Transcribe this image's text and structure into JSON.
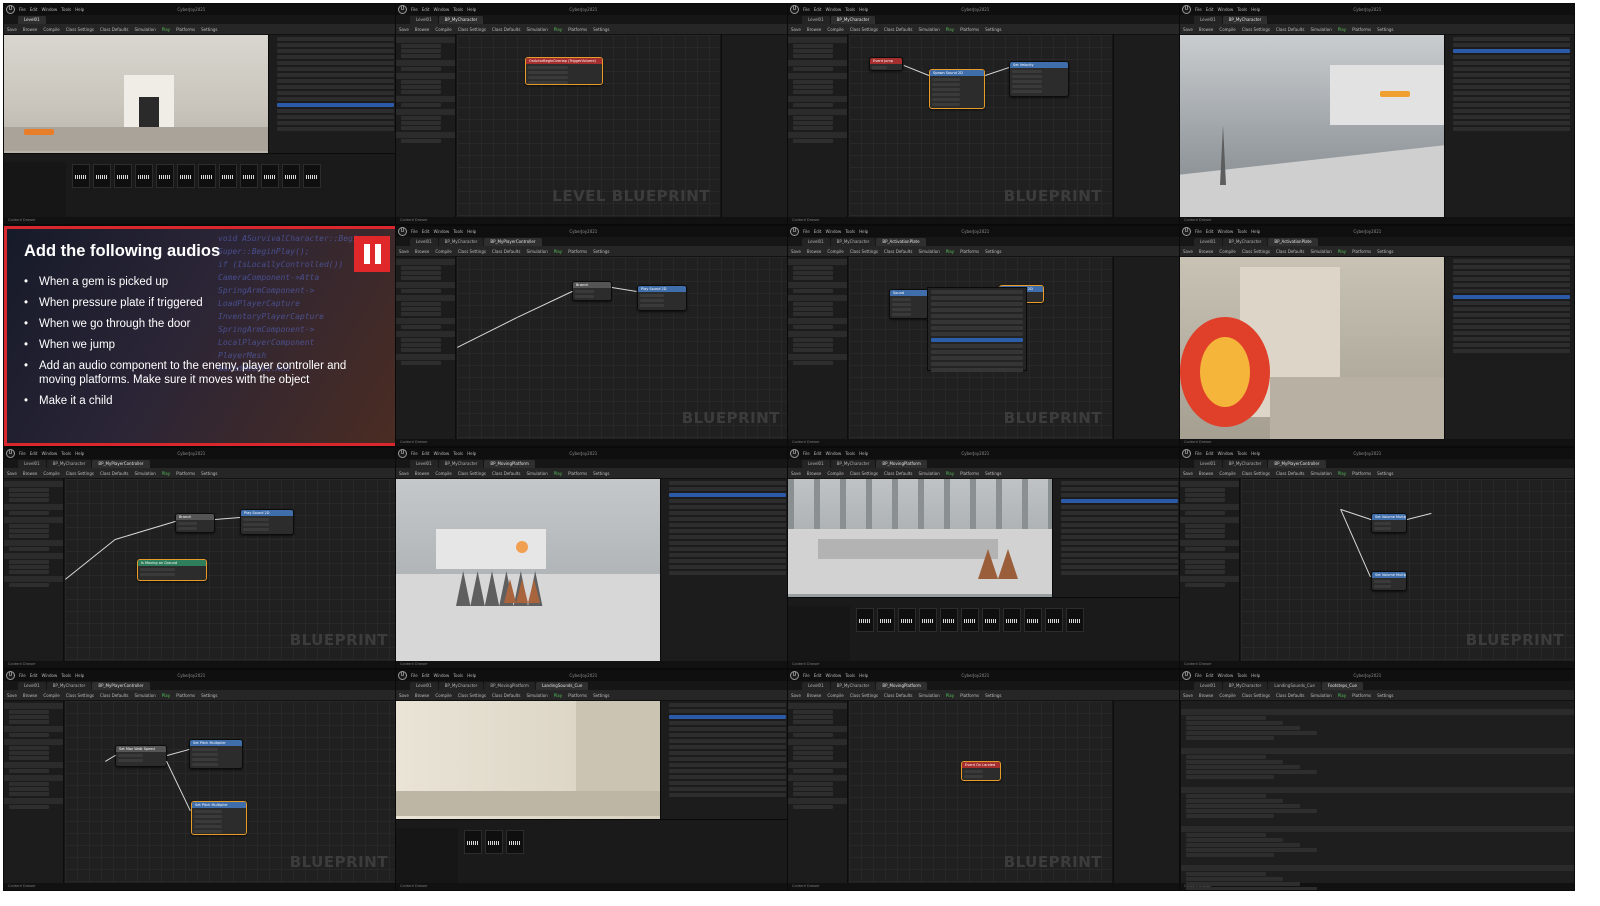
{
  "editor": {
    "project_name": "CyberJoy2021",
    "menu_items": [
      "File",
      "Edit",
      "Window",
      "Tools",
      "Help"
    ],
    "toolbar": [
      "Save",
      "Browse",
      "Compile",
      "Class Settings",
      "Class Defaults",
      "Simulation",
      "Play",
      "Platforms",
      "Settings"
    ],
    "status_text": "Content Drawer"
  },
  "tiles": [
    {
      "id": "t1",
      "kind": "level",
      "tabs": [
        "Level01"
      ]
    },
    {
      "id": "t2",
      "kind": "blueprint",
      "tabs": [
        "Level01",
        "BP_MyCharacter"
      ],
      "watermark": "LEVEL BLUEPRINT",
      "nodes": [
        {
          "title": "OnActorBeginOverlap (TriggerVolume)",
          "color": "#a52e2e"
        }
      ]
    },
    {
      "id": "t3",
      "kind": "blueprint",
      "tabs": [
        "Level01",
        "BP_MyCharacter"
      ],
      "watermark": "BLUEPRINT",
      "nodes": [
        {
          "title": "Event Jump",
          "color": "#a52e2e"
        },
        {
          "title": "Spawn Sound 2D",
          "color": "#3f6eaa"
        },
        {
          "title": "Set Velocity",
          "color": "#3f6eaa"
        }
      ]
    },
    {
      "id": "t4",
      "kind": "viewport-outliner",
      "tabs": [
        "Level01",
        "BP_MyCharacter"
      ]
    },
    {
      "id": "t5",
      "kind": "slide"
    },
    {
      "id": "t6",
      "kind": "blueprint",
      "tabs": [
        "Level01",
        "BP_MyCharacter",
        "BP_MyPlayerController"
      ],
      "watermark": "BLUEPRINT",
      "nodes": [
        {
          "title": "Branch",
          "color": "#555555"
        },
        {
          "title": "Play Sound 2D",
          "color": "#3f6eaa"
        }
      ]
    },
    {
      "id": "t7",
      "kind": "blueprint-menu",
      "tabs": [
        "Level01",
        "BP_MyCharacter",
        "BP_ActivationPlate"
      ],
      "watermark": "BLUEPRINT",
      "nodes": [
        {
          "title": "Sound",
          "color": "#3f6eaa"
        },
        {
          "title": "Spawn Sound 2D",
          "color": "#3f6eaa"
        }
      ]
    },
    {
      "id": "t8",
      "kind": "viewport-menu",
      "tabs": [
        "Level01",
        "BP_MyCharacter",
        "BP_ActivationPlate"
      ]
    },
    {
      "id": "t9",
      "kind": "blueprint",
      "tabs": [
        "Level01",
        "BP_MyCharacter",
        "BP_MyPlayerController"
      ],
      "watermark": "BLUEPRINT",
      "nodes": [
        {
          "title": "Branch",
          "color": "#555555"
        },
        {
          "title": "Play Sound 2D",
          "color": "#3f6eaa"
        },
        {
          "title": "Is Moving on Ground",
          "color": "#2e7d5b"
        }
      ]
    },
    {
      "id": "t10",
      "kind": "viewport-outliner",
      "tabs": [
        "Level01",
        "BP_MyCharacter",
        "BP_MovingPlatform"
      ]
    },
    {
      "id": "t11",
      "kind": "viewport-browser",
      "tabs": [
        "Level01",
        "BP_MyCharacter",
        "BP_MovingPlatform"
      ]
    },
    {
      "id": "t12",
      "kind": "blueprint",
      "tabs": [
        "Level01",
        "BP_MyCharacter",
        "BP_MyPlayerController"
      ],
      "watermark": "BLUEPRINT",
      "nodes": [
        {
          "title": "Set Volume Multiplier",
          "color": "#3f6eaa"
        },
        {
          "title": "Set Volume Multiplier",
          "color": "#3f6eaa"
        }
      ]
    },
    {
      "id": "t13",
      "kind": "blueprint",
      "tabs": [
        "Level01",
        "BP_MyCharacter",
        "BP_MyPlayerController"
      ],
      "watermark": "BLUEPRINT",
      "nodes": [
        {
          "title": "Set Max Walk Speed",
          "color": "#555555"
        },
        {
          "title": "Set Pitch Multiplier",
          "color": "#3f6eaa"
        },
        {
          "title": "Set Pitch Multiplier",
          "color": "#3f6eaa"
        }
      ]
    },
    {
      "id": "t14",
      "kind": "viewport-browser2",
      "tabs": [
        "Level01",
        "BP_MyCharacter",
        "BP_MovingPlatform",
        "LandingSounds_Cue"
      ]
    },
    {
      "id": "t15",
      "kind": "blueprint",
      "tabs": [
        "Level01",
        "BP_MyCharacter",
        "BP_MovingPlatform"
      ],
      "watermark": "BLUEPRINT",
      "nodes": [
        {
          "title": "Event On Landed",
          "color": "#a52e2e"
        }
      ]
    },
    {
      "id": "t16",
      "kind": "details",
      "tabs": [
        "Level01",
        "BP_MyCharacter",
        "LandingSounds_Cue",
        "Footsteps_Cue"
      ]
    }
  ],
  "slide": {
    "title": "Add the following audios",
    "bullets": [
      "When a gem is picked up",
      "When pressure plate if triggered",
      "When we go through the door",
      "When we jump",
      "Add an audio component to the enemy, player controller and moving platforms. Make sure it moves with the object",
      "Make it a child"
    ],
    "code_lines": [
      "void ASurvivalCharacter::Begi",
      "Super::BeginPlay();",
      "if (IsLocallyControlled())",
      "CameraComponent->Atta",
      "SpringArmComponent->",
      "LoadPlayerCapture",
      "InventoryPlayerCapture",
      "SpringArmComponent->",
      "LocalPlayerComponent",
      "PlayerMesh",
      "NakedMeshes.Add"
    ]
  },
  "colors": {
    "accent_selected": "#e79b2a",
    "slide_red": "#e0272a",
    "play_green": "#54c05a"
  }
}
